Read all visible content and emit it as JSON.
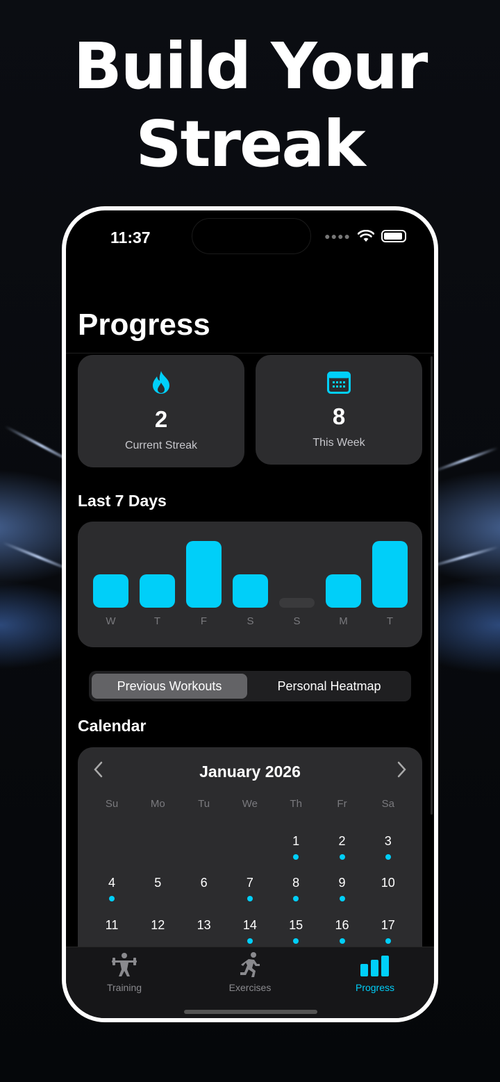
{
  "headline": {
    "line1": "Build Your",
    "line2": "Streak"
  },
  "status": {
    "time": "11:37"
  },
  "page": {
    "title": "Progress"
  },
  "stats": [
    {
      "value": "2",
      "label": "Current Streak",
      "icon": "flame-icon"
    },
    {
      "value": "8",
      "label": "This Week",
      "icon": "calendar-icon"
    }
  ],
  "last7": {
    "title": "Last 7 Days",
    "chart_data": {
      "type": "bar",
      "categories": [
        "W",
        "T",
        "F",
        "S",
        "S",
        "M",
        "T"
      ],
      "values": [
        1,
        1,
        2,
        1,
        0,
        1,
        2
      ]
    }
  },
  "segments": {
    "active": "Previous Workouts",
    "inactive": "Personal Heatmap"
  },
  "calendar": {
    "title": "Calendar",
    "month": "January 2026",
    "weekdays": [
      "Su",
      "Mo",
      "Tu",
      "We",
      "Th",
      "Fr",
      "Sa"
    ],
    "rows": [
      [
        null,
        null,
        null,
        null,
        {
          "d": "1",
          "dot": true
        },
        {
          "d": "2",
          "dot": true
        },
        {
          "d": "3",
          "dot": true
        }
      ],
      [
        {
          "d": "4",
          "dot": true
        },
        {
          "d": "5",
          "dot": false
        },
        {
          "d": "6",
          "dot": false
        },
        {
          "d": "7",
          "dot": true
        },
        {
          "d": "8",
          "dot": true
        },
        {
          "d": "9",
          "dot": true
        },
        {
          "d": "10",
          "dot": false
        }
      ],
      [
        {
          "d": "11",
          "dot": false
        },
        {
          "d": "12",
          "dot": false
        },
        {
          "d": "13",
          "dot": false
        },
        {
          "d": "14",
          "dot": true
        },
        {
          "d": "15",
          "dot": true
        },
        {
          "d": "16",
          "dot": true
        },
        {
          "d": "17",
          "dot": true
        }
      ]
    ]
  },
  "tabs": [
    {
      "label": "Training",
      "active": false
    },
    {
      "label": "Exercises",
      "active": false
    },
    {
      "label": "Progress",
      "active": true
    }
  ],
  "colors": {
    "accent": "#00cff9",
    "card": "#2c2c2e",
    "inactive": "#8a8a8e"
  }
}
